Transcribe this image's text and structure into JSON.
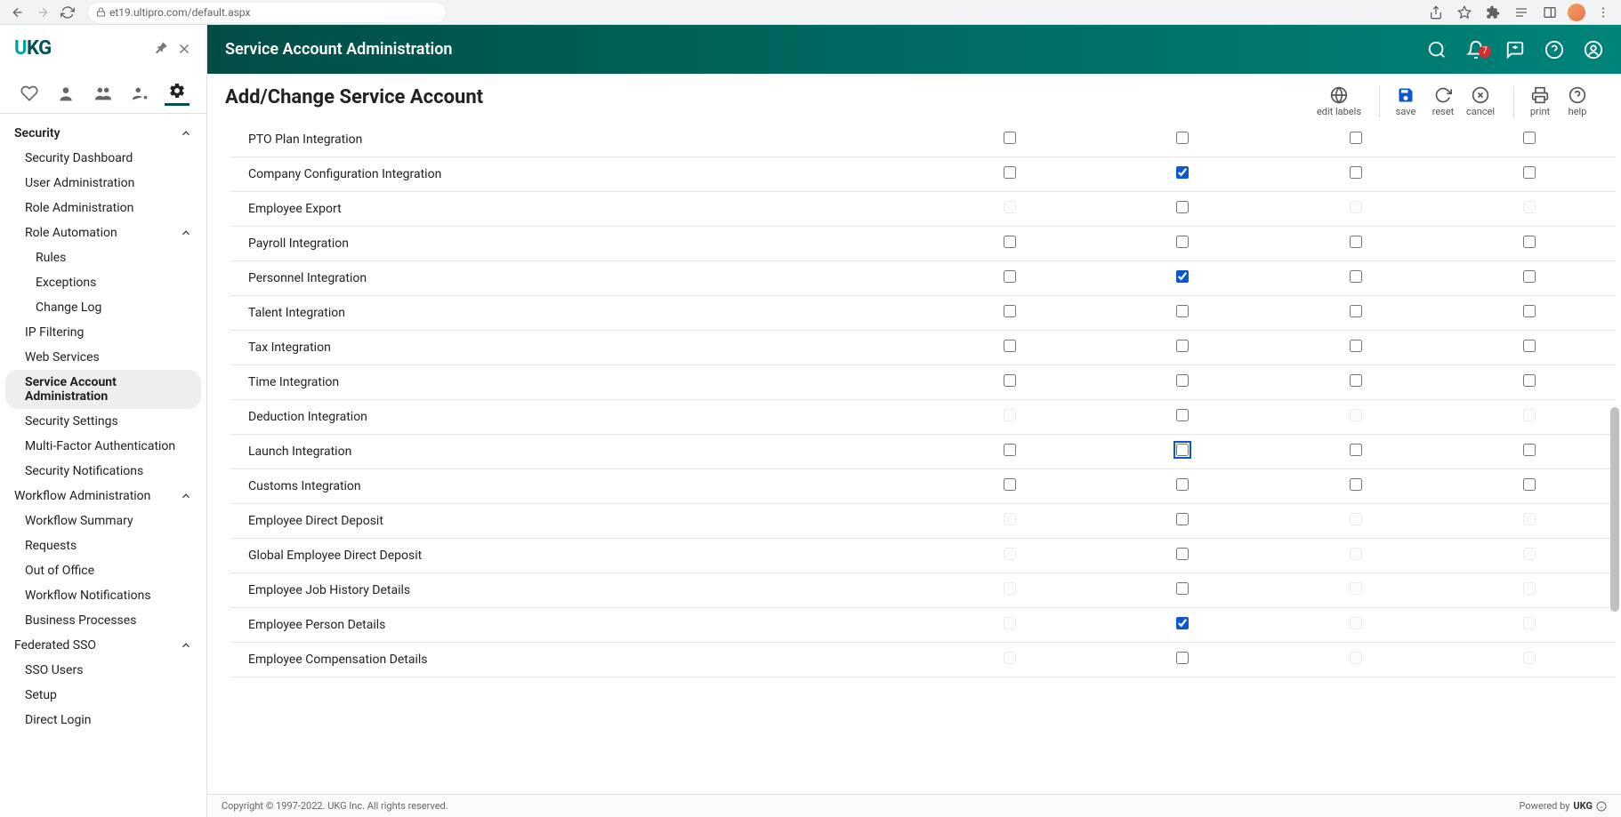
{
  "browser": {
    "url": "et19.ultipro.com/default.aspx"
  },
  "logo": {
    "text": "UKG"
  },
  "notifications": {
    "count": "7"
  },
  "header": {
    "title": "Service Account Administration"
  },
  "page": {
    "title": "Add/Change Service Account"
  },
  "actions": {
    "editLabels": "edit labels",
    "save": "save",
    "reset": "reset",
    "cancel": "cancel",
    "print": "print",
    "help": "help"
  },
  "sidebar": {
    "security": {
      "label": "Security",
      "items": {
        "dashboard": "Security Dashboard",
        "userAdmin": "User Administration",
        "roleAdmin": "Role Administration",
        "roleAuto": {
          "label": "Role Automation",
          "rules": "Rules",
          "exceptions": "Exceptions",
          "changeLog": "Change Log"
        },
        "ipFiltering": "IP Filtering",
        "webServices": "Web Services",
        "serviceAccount": "Service Account Administration",
        "securitySettings": "Security Settings",
        "mfa": "Multi-Factor Authentication",
        "securityNotifications": "Security Notifications"
      }
    },
    "workflow": {
      "label": "Workflow Administration",
      "items": {
        "summary": "Workflow Summary",
        "requests": "Requests",
        "ooo": "Out of Office",
        "notifications": "Workflow Notifications",
        "processes": "Business Processes"
      }
    },
    "sso": {
      "label": "Federated SSO",
      "items": {
        "users": "SSO Users",
        "setup": "Setup",
        "directLogin": "Direct Login"
      }
    }
  },
  "permissions": [
    {
      "name": "PTO Plan Integration",
      "c1": {
        "v": false,
        "d": false
      },
      "c2": {
        "v": false,
        "d": false
      },
      "c3": {
        "v": false,
        "d": false
      },
      "c4": {
        "v": false,
        "d": false
      }
    },
    {
      "name": "Company Configuration Integration",
      "c1": {
        "v": false,
        "d": false
      },
      "c2": {
        "v": true,
        "d": false
      },
      "c3": {
        "v": false,
        "d": false
      },
      "c4": {
        "v": false,
        "d": false
      }
    },
    {
      "name": "Employee Export",
      "c1": {
        "v": false,
        "d": true
      },
      "c2": {
        "v": false,
        "d": false
      },
      "c3": {
        "v": false,
        "d": true
      },
      "c4": {
        "v": false,
        "d": true
      }
    },
    {
      "name": "Payroll Integration",
      "c1": {
        "v": false,
        "d": false
      },
      "c2": {
        "v": false,
        "d": false
      },
      "c3": {
        "v": false,
        "d": false
      },
      "c4": {
        "v": false,
        "d": false
      }
    },
    {
      "name": "Personnel Integration",
      "c1": {
        "v": false,
        "d": false
      },
      "c2": {
        "v": true,
        "d": false
      },
      "c3": {
        "v": false,
        "d": false
      },
      "c4": {
        "v": false,
        "d": false
      }
    },
    {
      "name": "Talent Integration",
      "c1": {
        "v": false,
        "d": false
      },
      "c2": {
        "v": false,
        "d": false
      },
      "c3": {
        "v": false,
        "d": false
      },
      "c4": {
        "v": false,
        "d": false
      }
    },
    {
      "name": "Tax Integration",
      "c1": {
        "v": false,
        "d": false
      },
      "c2": {
        "v": false,
        "d": false
      },
      "c3": {
        "v": false,
        "d": false
      },
      "c4": {
        "v": false,
        "d": false
      }
    },
    {
      "name": "Time Integration",
      "c1": {
        "v": false,
        "d": false
      },
      "c2": {
        "v": false,
        "d": false
      },
      "c3": {
        "v": false,
        "d": false
      },
      "c4": {
        "v": false,
        "d": false
      }
    },
    {
      "name": "Deduction Integration",
      "c1": {
        "v": false,
        "d": true
      },
      "c2": {
        "v": false,
        "d": false
      },
      "c3": {
        "v": false,
        "d": true
      },
      "c4": {
        "v": false,
        "d": true
      }
    },
    {
      "name": "Launch Integration",
      "c1": {
        "v": false,
        "d": false
      },
      "c2": {
        "v": false,
        "d": false,
        "f": true
      },
      "c3": {
        "v": false,
        "d": false
      },
      "c4": {
        "v": false,
        "d": false
      }
    },
    {
      "name": "Customs Integration",
      "c1": {
        "v": false,
        "d": false
      },
      "c2": {
        "v": false,
        "d": false
      },
      "c3": {
        "v": false,
        "d": false
      },
      "c4": {
        "v": false,
        "d": false
      }
    },
    {
      "name": "Employee Direct Deposit",
      "c1": {
        "v": false,
        "d": true
      },
      "c2": {
        "v": false,
        "d": false
      },
      "c3": {
        "v": false,
        "d": true
      },
      "c4": {
        "v": false,
        "d": true
      }
    },
    {
      "name": "Global Employee Direct Deposit",
      "c1": {
        "v": false,
        "d": true
      },
      "c2": {
        "v": false,
        "d": false
      },
      "c3": {
        "v": false,
        "d": true
      },
      "c4": {
        "v": false,
        "d": true
      }
    },
    {
      "name": "Employee Job History Details",
      "c1": {
        "v": false,
        "d": true
      },
      "c2": {
        "v": false,
        "d": false
      },
      "c3": {
        "v": false,
        "d": true
      },
      "c4": {
        "v": false,
        "d": true
      }
    },
    {
      "name": "Employee Person Details",
      "c1": {
        "v": false,
        "d": true
      },
      "c2": {
        "v": true,
        "d": false
      },
      "c3": {
        "v": false,
        "d": true
      },
      "c4": {
        "v": false,
        "d": true
      }
    },
    {
      "name": "Employee Compensation Details",
      "c1": {
        "v": false,
        "d": true
      },
      "c2": {
        "v": false,
        "d": false
      },
      "c3": {
        "v": false,
        "d": true
      },
      "c4": {
        "v": false,
        "d": true
      }
    }
  ],
  "footer": {
    "copyright": "Copyright © 1997-2022. UKG Inc. All rights reserved.",
    "poweredBy": "Powered by",
    "brand": "UKG"
  }
}
